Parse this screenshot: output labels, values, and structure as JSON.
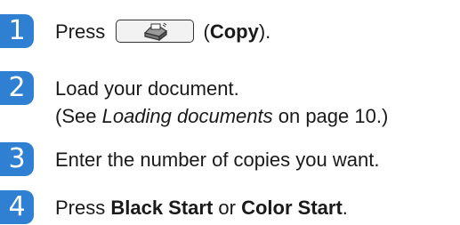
{
  "steps": [
    {
      "number": "1",
      "prefix": "Press",
      "button_icon": "copy-icon",
      "paren_open": "(",
      "button_label": "Copy",
      "paren_close": ")."
    },
    {
      "number": "2",
      "line1": "Load your document.",
      "line2_prefix": "(See ",
      "line2_link": "Loading documents",
      "line2_suffix": " on page 10.)"
    },
    {
      "number": "3",
      "text": "Enter the number of copies you want."
    },
    {
      "number": "4",
      "prefix": "Press ",
      "bold1": "Black Start",
      "middle": " or ",
      "bold2": "Color Start",
      "suffix": "."
    }
  ],
  "colors": {
    "step_badge": "#2f7fd3",
    "text": "#1a1a1a"
  }
}
